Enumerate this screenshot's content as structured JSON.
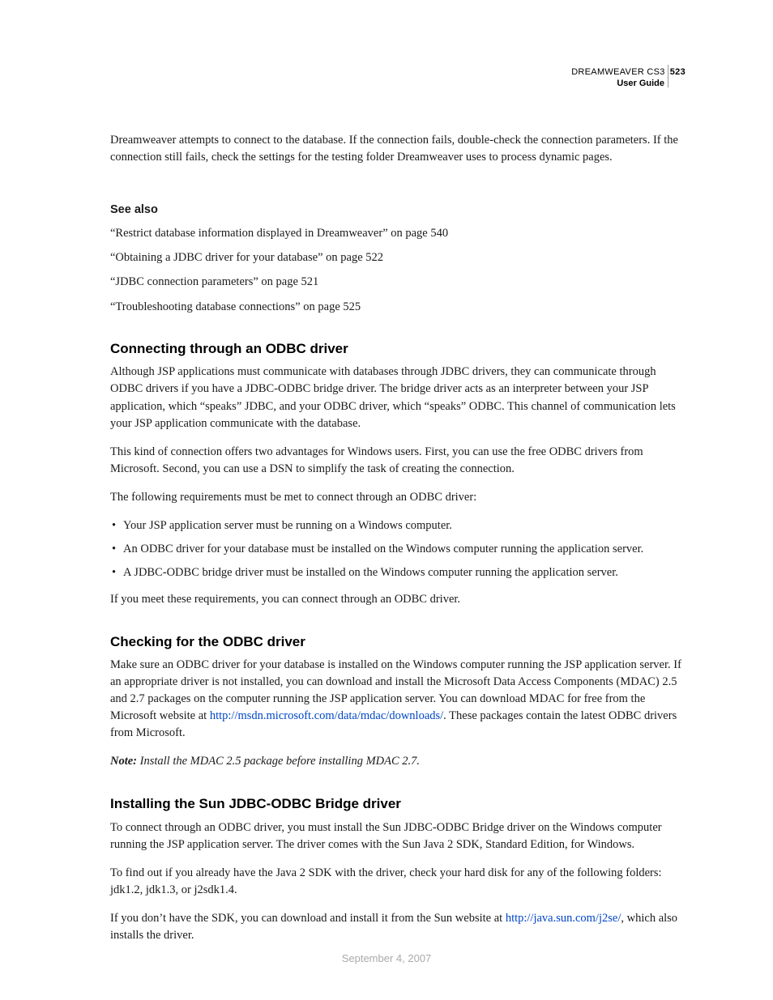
{
  "header": {
    "product": "DREAMWEAVER CS3",
    "page_number": "523",
    "subtitle": "User Guide"
  },
  "intro": "Dreamweaver attempts to connect to the database. If the connection fails, double-check the connection parameters. If the connection still fails, check the settings for the testing folder Dreamweaver uses to process dynamic pages.",
  "see_also": {
    "heading": "See also",
    "items": [
      "“Restrict database information displayed in Dreamweaver” on page 540",
      "“Obtaining a JDBC driver for your database” on page 522",
      "“JDBC connection parameters” on page 521",
      "“Troubleshooting database connections” on page 525"
    ]
  },
  "sec1": {
    "heading": "Connecting through an ODBC driver",
    "p1": "Although JSP applications must communicate with databases through JDBC drivers, they can communicate through ODBC drivers if you have a JDBC-ODBC bridge driver. The bridge driver acts as an interpreter between your JSP application, which “speaks” JDBC, and your ODBC driver, which “speaks” ODBC. This channel of communication lets your JSP application communicate with the database.",
    "p2": "This kind of connection offers two advantages for Windows users. First, you can use the free ODBC drivers from Microsoft. Second, you can use a DSN to simplify the task of creating the connection.",
    "p3": "The following requirements must be met to connect through an ODBC driver:",
    "bullets": [
      "Your JSP application server must be running on a Windows computer.",
      "An ODBC driver for your database must be installed on the Windows computer running the application server.",
      "A JDBC-ODBC bridge driver must be installed on the Windows computer running the application server."
    ],
    "p4": "If you meet these requirements, you can connect through an ODBC driver."
  },
  "sec2": {
    "heading": "Checking for the ODBC driver",
    "p1a": "Make sure an ODBC driver for your database is installed on the Windows computer running the JSP application server. If an appropriate driver is not installed, you can download and install the Microsoft Data Access Components (MDAC) 2.5 and 2.7 packages on the computer running the JSP application server. You can download MDAC for free from the Microsoft website at ",
    "link1": "http://msdn.microsoft.com/data/mdac/downloads/",
    "p1b": ". These packages contain the latest ODBC drivers from Microsoft.",
    "note_label": "Note: ",
    "note": "Install the MDAC 2.5 package before installing MDAC 2.7."
  },
  "sec3": {
    "heading": "Installing the Sun JDBC-ODBC Bridge driver",
    "p1": "To connect through an ODBC driver, you must install the Sun JDBC-ODBC Bridge driver on the Windows computer running the JSP application server. The driver comes with the Sun Java 2 SDK, Standard Edition, for Windows.",
    "p2": "To find out if you already have the Java 2 SDK with the driver, check your hard disk for any of the following folders: jdk1.2, jdk1.3, or j2sdk1.4.",
    "p3a": "If you don’t have the SDK, you can download and install it from the Sun website at ",
    "link1": "http://java.sun.com/j2se/",
    "p3b": ", which also installs the driver."
  },
  "footer": "September 4, 2007"
}
